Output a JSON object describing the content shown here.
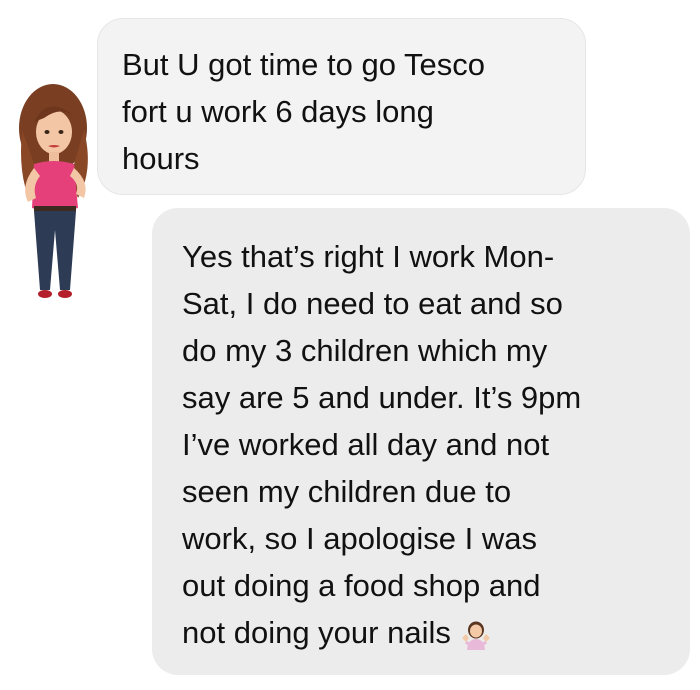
{
  "conversation": {
    "received_message": {
      "lines": [
        "But U got time to go Tesco",
        "fort u work 6 days long",
        "hours"
      ]
    },
    "sent_message": {
      "lines": [
        "Yes that’s right I work Mon-",
        "Sat, I do need to eat and so",
        "do my 3 children which my",
        "say are 5 and under. It’s 9pm",
        "I’ve worked all day and not",
        "seen my children due to",
        "work, so I apologise I was",
        "out doing a food shop and",
        "not doing your nails"
      ],
      "trailing_emoji": "person-shrugging-emoji"
    },
    "avatar": {
      "icon": "bitmoji-avatar-icon"
    }
  },
  "colors": {
    "background": "#ffffff",
    "bubble_received": "#f3f3f3",
    "bubble_sent": "#ececec",
    "text": "#111111"
  }
}
